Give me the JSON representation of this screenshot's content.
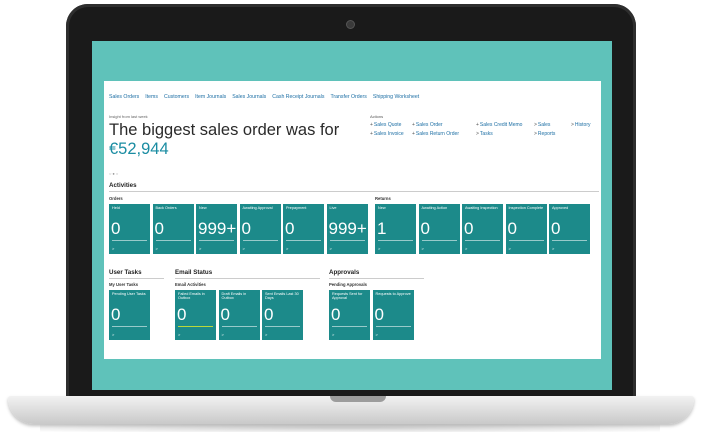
{
  "nav": [
    "Sales Orders",
    "Items",
    "Customers",
    "Item Journals",
    "Sales Journals",
    "Cash Receipt Journals",
    "Transfer Orders",
    "Shipping Worksheet"
  ],
  "insight": {
    "caption": "Insight from last week",
    "headline": "The biggest sales order was for ",
    "amount": "€52,944",
    "dots": "○●○"
  },
  "actions": {
    "caption": "Actions",
    "items": [
      {
        "sym": "+",
        "label": "Sales Quote"
      },
      {
        "sym": "+",
        "label": "Sales Order"
      },
      {
        "sym": "+",
        "label": "Sales Credit Memo"
      },
      {
        "sym": ">",
        "label": "Sales"
      },
      {
        "sym": ">",
        "label": "History"
      },
      {
        "sym": "+",
        "label": "Sales Invoice"
      },
      {
        "sym": "+",
        "label": "Sales Return Order"
      },
      {
        "sym": ">",
        "label": "Tasks"
      },
      {
        "sym": ">",
        "label": "Reports"
      }
    ]
  },
  "activities": {
    "title": "Activities",
    "orders_label": "Orders",
    "orders": [
      {
        "label": "Held",
        "value": "0"
      },
      {
        "label": "Back Orders",
        "value": "0"
      },
      {
        "label": "New",
        "value": "999+"
      },
      {
        "label": "Awaiting Approval",
        "value": "0"
      },
      {
        "label": "Prepayment",
        "value": "0"
      },
      {
        "label": "Live",
        "value": "999+"
      }
    ],
    "returns_label": "Returns",
    "returns": [
      {
        "label": "New",
        "value": "1"
      },
      {
        "label": "Awaiting Action",
        "value": "0"
      },
      {
        "label": "Awaiting Inspection",
        "value": "0"
      },
      {
        "label": "Inspection Complete",
        "value": "0"
      },
      {
        "label": "Approved",
        "value": "0"
      }
    ]
  },
  "user_tasks": {
    "title": "User Tasks",
    "group": "My User Tasks",
    "tiles": [
      {
        "label": "Pending User Tasks",
        "value": "0"
      }
    ]
  },
  "email_status": {
    "title": "Email Status",
    "group": "Email Activities",
    "tiles": [
      {
        "label": "Failed Emails in Outbox",
        "value": "0"
      },
      {
        "label": "Draft Emails in Outbox",
        "value": "0"
      },
      {
        "label": "Sent Emails Last 30 Days",
        "value": "0"
      }
    ]
  },
  "approvals": {
    "title": "Approvals",
    "group": "Pending Approvals",
    "tiles": [
      {
        "label": "Requests Sent for Approval",
        "value": "0"
      },
      {
        "label": "Requests to Approve",
        "value": "0"
      }
    ]
  },
  "tile_chevron": ">",
  "colors": {
    "tile": "#1c8a8a",
    "screen_bg": "#5fc2ba",
    "link": "#1c6ea4",
    "accent_amount": "#1a8ca2",
    "highlight_bar": "#b9d93a"
  }
}
